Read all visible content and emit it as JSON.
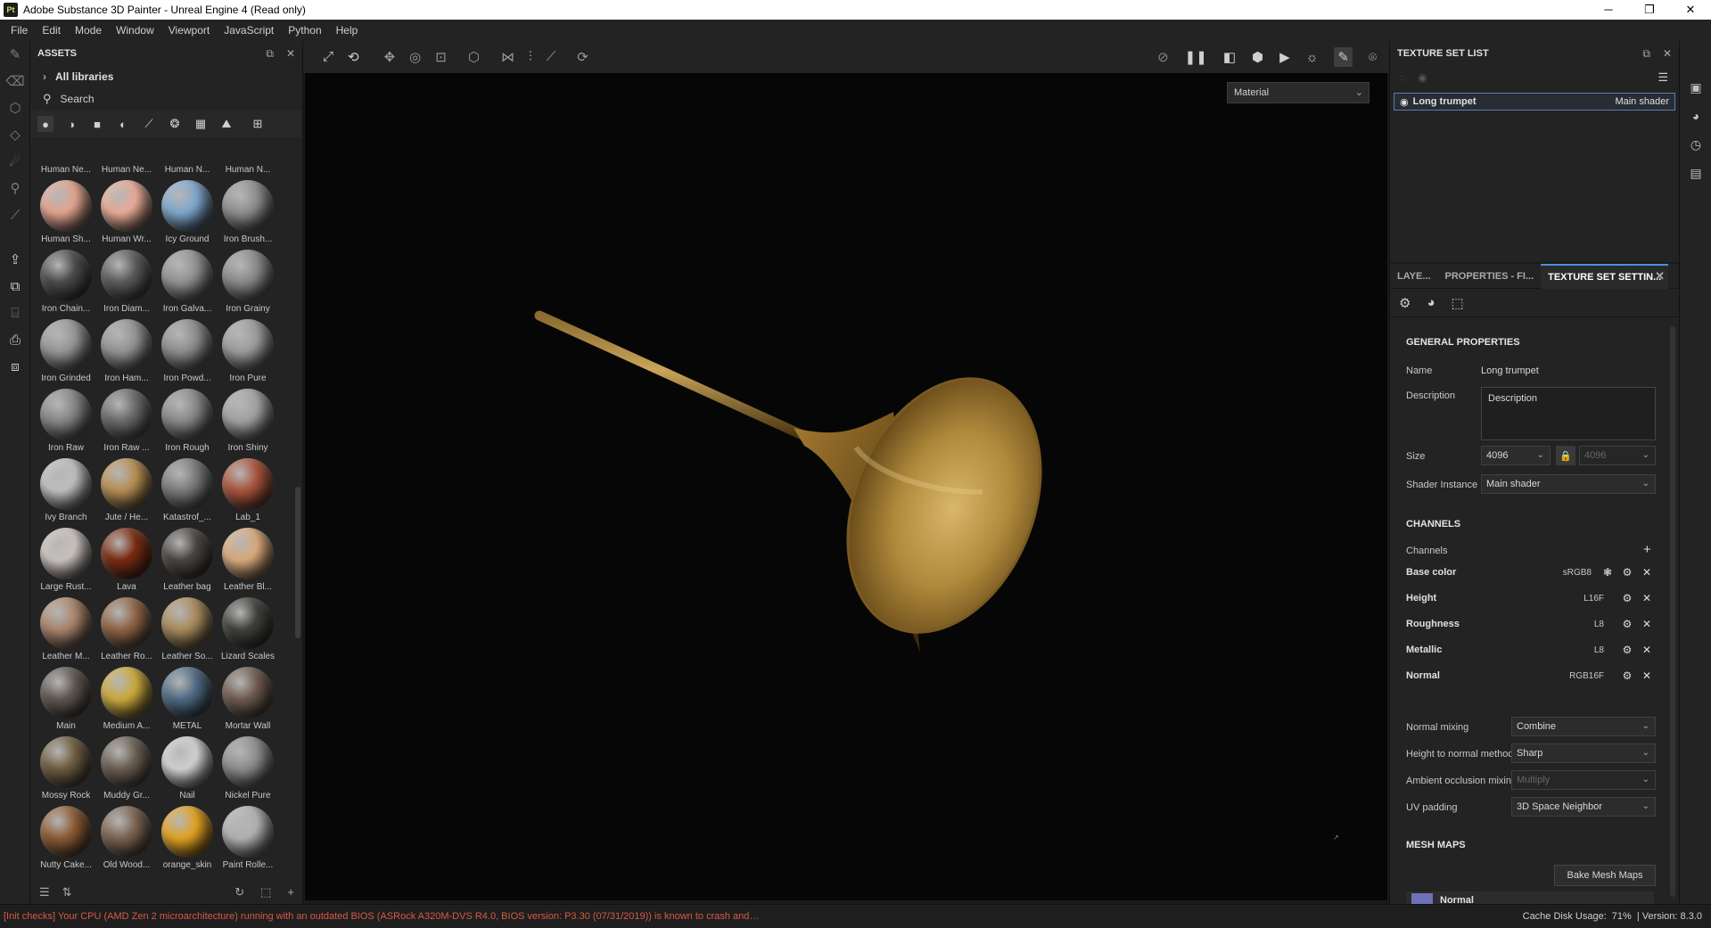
{
  "window": {
    "app_icon": "Pt",
    "title": "Adobe Substance 3D Painter - Unreal Engine 4 (Read only)",
    "min": "─",
    "max": "❐",
    "close": "✕"
  },
  "menu": [
    "File",
    "Edit",
    "Mode",
    "Window",
    "Viewport",
    "JavaScript",
    "Python",
    "Help"
  ],
  "assets": {
    "title": "ASSETS",
    "libraries": "All libraries",
    "search_placeholder": "Search",
    "items": [
      {
        "label": "Human Ne...",
        "color": "#c9907a"
      },
      {
        "label": "Human Ne...",
        "color": "#c48a76"
      },
      {
        "label": "Human N...",
        "color": "#bf8a78"
      },
      {
        "label": "Human N...",
        "color": "#c08b77"
      },
      {
        "label": "Human Sh...",
        "color": "#e0a48e"
      },
      {
        "label": "Human Wr...",
        "color": "#e7aa95"
      },
      {
        "label": "Icy Ground",
        "color": "#7ea6cc"
      },
      {
        "label": "Iron Brush...",
        "color": "#8e8e8e"
      },
      {
        "label": "Iron Chain...",
        "color": "#4a4a4a"
      },
      {
        "label": "Iron Diam...",
        "color": "#5a5a5a"
      },
      {
        "label": "Iron Galva...",
        "color": "#909090"
      },
      {
        "label": "Iron Grainy",
        "color": "#8a8a8a"
      },
      {
        "label": "Iron Grinded",
        "color": "#959595"
      },
      {
        "label": "Iron Ham...",
        "color": "#929292"
      },
      {
        "label": "Iron Powd...",
        "color": "#8c8c8c"
      },
      {
        "label": "Iron Pure",
        "color": "#9a9a9a"
      },
      {
        "label": "Iron Raw",
        "color": "#858585"
      },
      {
        "label": "Iron Raw ...",
        "color": "#6a6a6a"
      },
      {
        "label": "Iron Rough",
        "color": "#888888"
      },
      {
        "label": "Iron Shiny",
        "color": "#a0a0a0"
      },
      {
        "label": "Ivy Branch",
        "color": "#bdbdbd"
      },
      {
        "label": "Jute / He...",
        "color": "#b58d52"
      },
      {
        "label": "Katastrof_...",
        "color": "#7a7a7a"
      },
      {
        "label": "Lab_1",
        "color": "#a8533a"
      },
      {
        "label": "Large Rust...",
        "color": "#c8c0bc"
      },
      {
        "label": "Lava",
        "color": "#7a2a10"
      },
      {
        "label": "Leather bag",
        "color": "#4a4440"
      },
      {
        "label": "Leather Bl...",
        "color": "#d9a87a"
      },
      {
        "label": "Leather M...",
        "color": "#a8846a"
      },
      {
        "label": "Leather Ro...",
        "color": "#8e6444"
      },
      {
        "label": "Leather So...",
        "color": "#a88a5a"
      },
      {
        "label": "Lizard Scales",
        "color": "#3e403a"
      },
      {
        "label": "Main",
        "color": "#5e5650"
      },
      {
        "label": "Medium A...",
        "color": "#c9a83a"
      },
      {
        "label": "METAL",
        "color": "#4e6a84"
      },
      {
        "label": "Mortar Wall",
        "color": "#6e5a4e"
      },
      {
        "label": "Mossy Rock",
        "color": "#6e5c3e"
      },
      {
        "label": "Muddy Gr...",
        "color": "#6a5e52"
      },
      {
        "label": "Nail",
        "color": "#d0d0d0"
      },
      {
        "label": "Nickel Pure",
        "color": "#8c8c8c"
      },
      {
        "label": "Nutty Cake...",
        "color": "#8a5a32"
      },
      {
        "label": "Old Wood...",
        "color": "#7a6250"
      },
      {
        "label": "orange_skin",
        "color": "#e0a020"
      },
      {
        "label": "Paint Rolle...",
        "color": "#b0b0b0"
      }
    ]
  },
  "viewport": {
    "mode_select": "Material"
  },
  "texture_set_list": {
    "title": "TEXTURE SET LIST",
    "item_name": "Long trumpet",
    "item_shader": "Main shader"
  },
  "tss": {
    "tabs": [
      "LAYE...",
      "PROPERTIES - FI...",
      "TEXTURE SET SETTIN..."
    ],
    "general_title": "GENERAL PROPERTIES",
    "name_label": "Name",
    "name_value": "Long trumpet",
    "description_label": "Description",
    "description_value": "Description",
    "size_label": "Size",
    "size_value": "4096",
    "size_value_locked": "4096",
    "shader_label": "Shader Instance",
    "shader_value": "Main shader",
    "channels_title": "CHANNELS",
    "channels_label": "Channels",
    "channels": [
      {
        "name": "Base color",
        "format": "sRGB8"
      },
      {
        "name": "Height",
        "format": "L16F"
      },
      {
        "name": "Roughness",
        "format": "L8"
      },
      {
        "name": "Metallic",
        "format": "L8"
      },
      {
        "name": "Normal",
        "format": "RGB16F"
      }
    ],
    "normal_mixing_label": "Normal mixing",
    "normal_mixing_value": "Combine",
    "h2n_label": "Height to normal method",
    "h2n_value": "Sharp",
    "ao_label": "Ambient occlusion mixing",
    "ao_value": "Multiply",
    "uv_label": "UV padding",
    "uv_value": "3D Space Neighbor",
    "mesh_maps_title": "MESH MAPS",
    "bake_button": "Bake Mesh Maps",
    "mesh_map_first": "Normal"
  },
  "status": {
    "warning": "[Init checks] Your CPU (AMD Zen 2 microarchitecture) running with an outdated BIOS (ASRock A320M-DVS R4.0, BIOS version: P3.30 (07/31/2019)) is known to crash and/or ...",
    "cache": "Cache Disk Usage:",
    "cache_value": "71%",
    "version": "| Version: 8.3.0"
  }
}
